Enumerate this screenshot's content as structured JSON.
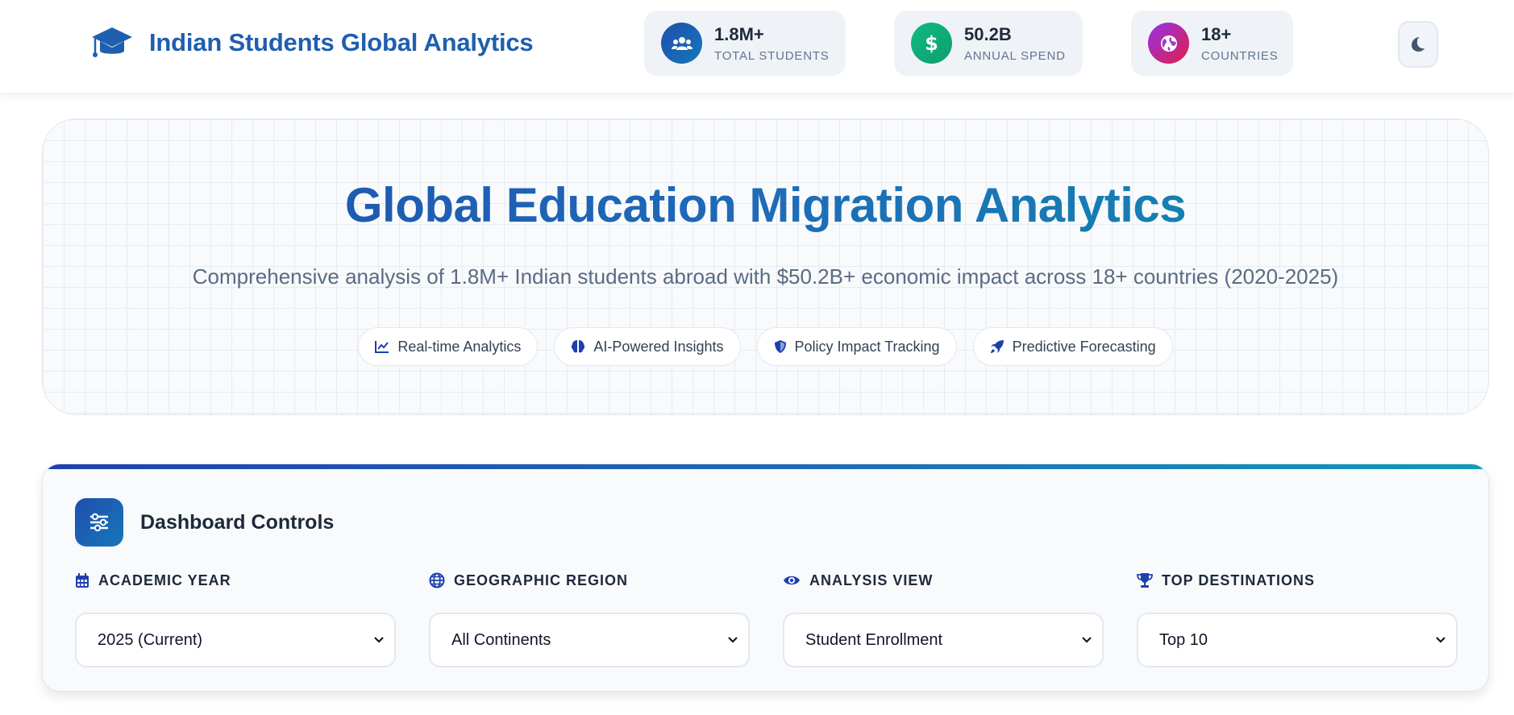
{
  "header": {
    "brand_title": "Indian Students Global Analytics",
    "stats": [
      {
        "value": "1.8M+",
        "label": "TOTAL STUDENTS",
        "icon": "users-icon",
        "color": "#1e5fae"
      },
      {
        "value": "50.2B",
        "label": "ANNUAL SPEND",
        "icon": "dollar-icon",
        "color": "#10b981"
      },
      {
        "value": "18+",
        "label": "COUNTRIES",
        "icon": "globe-icon",
        "color": "#9333ea"
      }
    ],
    "theme_toggle_icon": "moon-icon"
  },
  "hero": {
    "title": "Global Education Migration Analytics",
    "subtitle": "Comprehensive analysis of 1.8M+ Indian students abroad with $50.2B+ economic impact across 18+ countries (2020-2025)",
    "pills": [
      {
        "label": "Real-time Analytics",
        "icon": "line-chart-icon"
      },
      {
        "label": "AI-Powered Insights",
        "icon": "brain-icon"
      },
      {
        "label": "Policy Impact Tracking",
        "icon": "shield-icon"
      },
      {
        "label": "Predictive Forecasting",
        "icon": "rocket-icon"
      }
    ]
  },
  "controls": {
    "title": "Dashboard Controls",
    "fields": [
      {
        "label": "ACADEMIC YEAR",
        "icon": "calendar-icon",
        "value": "2025 (Current)"
      },
      {
        "label": "GEOGRAPHIC REGION",
        "icon": "globe-icon",
        "value": "All Continents"
      },
      {
        "label": "ANALYSIS VIEW",
        "icon": "eye-icon",
        "value": "Student Enrollment"
      },
      {
        "label": "TOP DESTINATIONS",
        "icon": "trophy-icon",
        "value": "Top 10"
      }
    ]
  },
  "colors": {
    "brand_blue": "#1e5fae",
    "accent_teal": "#0e8fae",
    "spend_green": "#10b981",
    "countries_purple": "#9333ea"
  }
}
